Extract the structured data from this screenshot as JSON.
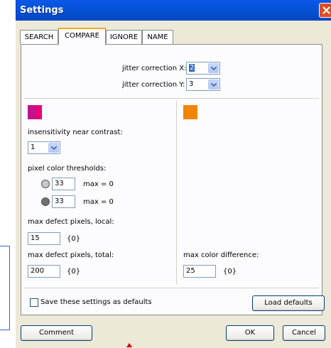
{
  "window": {
    "title": "Settings"
  },
  "tabs": [
    {
      "label": "SEARCH",
      "active": false
    },
    {
      "label": "COMPARE",
      "active": true
    },
    {
      "label": "IGNORE",
      "active": false
    },
    {
      "label": "NAME",
      "active": false
    }
  ],
  "jitter": {
    "x_label": "jitter correction X:",
    "x_value": "2",
    "y_label": "jitter correction Y:",
    "y_value": "3"
  },
  "left": {
    "swatch_colors": [
      "#c0138a",
      "#e8007a"
    ],
    "insensitivity_label": "insensitivity near contrast:",
    "insensitivity_value": "1",
    "thresholds_label": "pixel color thresholds:",
    "threshold1": {
      "value": "33",
      "max": "max = 0",
      "radio_color": "#c8c8c8"
    },
    "threshold2": {
      "value": "33",
      "max": "max = 0",
      "radio_color": "#707070"
    },
    "local_label": "max defect pixels, local:",
    "local_value": "15",
    "local_suffix": "{0}",
    "total_label": "max defect pixels, total:",
    "total_value": "200",
    "total_suffix": "{0}"
  },
  "right": {
    "swatch_color": "#f28500",
    "color_diff_label": "max color difference:",
    "color_diff_value": "25",
    "color_diff_suffix": "{0}"
  },
  "footer": {
    "save_defaults_label": "Save these settings as defaults",
    "load_defaults_label": "Load defaults",
    "comment_label": "Comment",
    "ok_label": "OK",
    "cancel_label": "Cancel"
  }
}
